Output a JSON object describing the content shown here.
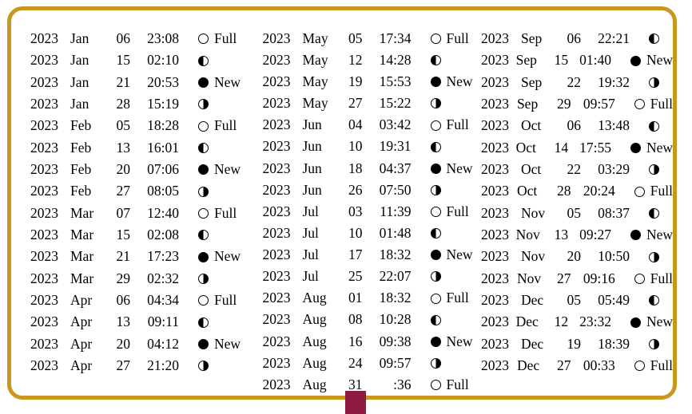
{
  "panel": {
    "border_color": "#c8981e",
    "background_color": "#ffffff"
  },
  "artifact": {
    "name": "cursor-artifact",
    "color": "#8e1b41"
  },
  "phase_labels": {
    "full": "Full",
    "new": "New",
    "first_quarter": "",
    "last_quarter": ""
  },
  "icons": {
    "full": "moon-full-icon",
    "new": "moon-new-icon",
    "first_quarter": "moon-first-quarter-icon",
    "last_quarter": "moon-last-quarter-icon"
  },
  "columns": [
    {
      "rows": [
        {
          "year": "2023",
          "month": "Jan",
          "day": "06",
          "time": "23:08",
          "phase": "full",
          "label": "Full"
        },
        {
          "year": "2023",
          "month": "Jan",
          "day": "15",
          "time": "02:10",
          "phase": "q1",
          "label": ""
        },
        {
          "year": "2023",
          "month": "Jan",
          "day": "21",
          "time": "20:53",
          "phase": "new",
          "label": "New"
        },
        {
          "year": "2023",
          "month": "Jan",
          "day": "28",
          "time": "15:19",
          "phase": "q3",
          "label": ""
        },
        {
          "year": "2023",
          "month": "Feb",
          "day": "05",
          "time": "18:28",
          "phase": "full",
          "label": "Full"
        },
        {
          "year": "2023",
          "month": "Feb",
          "day": "13",
          "time": "16:01",
          "phase": "q1",
          "label": ""
        },
        {
          "year": "2023",
          "month": "Feb",
          "day": "20",
          "time": "07:06",
          "phase": "new",
          "label": "New"
        },
        {
          "year": "2023",
          "month": "Feb",
          "day": "27",
          "time": "08:05",
          "phase": "q3",
          "label": ""
        },
        {
          "year": "2023",
          "month": "Mar",
          "day": "07",
          "time": "12:40",
          "phase": "full",
          "label": "Full"
        },
        {
          "year": "2023",
          "month": "Mar",
          "day": "15",
          "time": "02:08",
          "phase": "q1",
          "label": ""
        },
        {
          "year": "2023",
          "month": "Mar",
          "day": "21",
          "time": "17:23",
          "phase": "new",
          "label": "New"
        },
        {
          "year": "2023",
          "month": "Mar",
          "day": "29",
          "time": "02:32",
          "phase": "q3",
          "label": ""
        },
        {
          "year": "2023",
          "month": "Apr",
          "day": "06",
          "time": "04:34",
          "phase": "full",
          "label": "Full"
        },
        {
          "year": "2023",
          "month": "Apr",
          "day": "13",
          "time": "09:11",
          "phase": "q1",
          "label": ""
        },
        {
          "year": "2023",
          "month": "Apr",
          "day": "20",
          "time": "04:12",
          "phase": "new",
          "label": "New"
        },
        {
          "year": "2023",
          "month": "Apr",
          "day": "27",
          "time": "21:20",
          "phase": "q3",
          "label": ""
        }
      ]
    },
    {
      "rows": [
        {
          "year": "2023",
          "month": "May",
          "day": "05",
          "time": "17:34",
          "phase": "full",
          "label": "Full"
        },
        {
          "year": "2023",
          "month": "May",
          "day": "12",
          "time": "14:28",
          "phase": "q1",
          "label": ""
        },
        {
          "year": "2023",
          "month": "May",
          "day": "19",
          "time": "15:53",
          "phase": "new",
          "label": "New"
        },
        {
          "year": "2023",
          "month": "May",
          "day": "27",
          "time": "15:22",
          "phase": "q3",
          "label": ""
        },
        {
          "year": "2023",
          "month": "Jun",
          "day": "04",
          "time": "03:42",
          "phase": "full",
          "label": "Full"
        },
        {
          "year": "2023",
          "month": "Jun",
          "day": "10",
          "time": "19:31",
          "phase": "q1",
          "label": ""
        },
        {
          "year": "2023",
          "month": "Jun",
          "day": "18",
          "time": "04:37",
          "phase": "new",
          "label": "New"
        },
        {
          "year": "2023",
          "month": "Jun",
          "day": "26",
          "time": "07:50",
          "phase": "q3",
          "label": ""
        },
        {
          "year": "2023",
          "month": "Jul",
          "day": "03",
          "time": "11:39",
          "phase": "full",
          "label": "Full"
        },
        {
          "year": "2023",
          "month": "Jul",
          "day": "10",
          "time": "01:48",
          "phase": "q1",
          "label": ""
        },
        {
          "year": "2023",
          "month": "Jul",
          "day": "17",
          "time": "18:32",
          "phase": "new",
          "label": "New"
        },
        {
          "year": "2023",
          "month": "Jul",
          "day": "25",
          "time": "22:07",
          "phase": "q3",
          "label": ""
        },
        {
          "year": "2023",
          "month": "Aug",
          "day": "01",
          "time": "18:32",
          "phase": "full",
          "label": "Full"
        },
        {
          "year": "2023",
          "month": "Aug",
          "day": "08",
          "time": "10:28",
          "phase": "q1",
          "label": ""
        },
        {
          "year": "2023",
          "month": "Aug",
          "day": "16",
          "time": "09:38",
          "phase": "new",
          "label": "New"
        },
        {
          "year": "2023",
          "month": "Aug",
          "day": "24",
          "time": "09:57",
          "phase": "q3",
          "label": ""
        },
        {
          "year": "2023",
          "month": "Aug",
          "day": "31",
          "time": ":36",
          "phase": "full",
          "label": "Full"
        }
      ]
    },
    {
      "rows": [
        {
          "year": "2023",
          "month": "Sep",
          "day": "06",
          "time": "22:21",
          "phase": "q1",
          "label": ""
        },
        {
          "year": "2023",
          "month": "Sep",
          "day": "15",
          "time": "01:40",
          "phase": "new",
          "label": "New"
        },
        {
          "year": "2023",
          "month": "Sep",
          "day": "22",
          "time": "19:32",
          "phase": "q3",
          "label": ""
        },
        {
          "year": "2023",
          "month": "Sep",
          "day": "29",
          "time": "09:57",
          "phase": "full",
          "label": "Full"
        },
        {
          "year": "2023",
          "month": "Oct",
          "day": "06",
          "time": "13:48",
          "phase": "q1",
          "label": ""
        },
        {
          "year": "2023",
          "month": "Oct",
          "day": "14",
          "time": "17:55",
          "phase": "new",
          "label": "New"
        },
        {
          "year": "2023",
          "month": "Oct",
          "day": "22",
          "time": "03:29",
          "phase": "q3",
          "label": ""
        },
        {
          "year": "2023",
          "month": "Oct",
          "day": "28",
          "time": "20:24",
          "phase": "full",
          "label": "Full"
        },
        {
          "year": "2023",
          "month": "Nov",
          "day": "05",
          "time": "08:37",
          "phase": "q1",
          "label": ""
        },
        {
          "year": "2023",
          "month": "Nov",
          "day": "13",
          "time": "09:27",
          "phase": "new",
          "label": "New"
        },
        {
          "year": "2023",
          "month": "Nov",
          "day": "20",
          "time": "10:50",
          "phase": "q3",
          "label": ""
        },
        {
          "year": "2023",
          "month": "Nov",
          "day": "27",
          "time": "09:16",
          "phase": "full",
          "label": "Full"
        },
        {
          "year": "2023",
          "month": "Dec",
          "day": "05",
          "time": "05:49",
          "phase": "q1",
          "label": ""
        },
        {
          "year": "2023",
          "month": "Dec",
          "day": "12",
          "time": "23:32",
          "phase": "new",
          "label": "New"
        },
        {
          "year": "2023",
          "month": "Dec",
          "day": "19",
          "time": "18:39",
          "phase": "q3",
          "label": ""
        },
        {
          "year": "2023",
          "month": "Dec",
          "day": "27",
          "time": "00:33",
          "phase": "full",
          "label": "Full"
        }
      ]
    }
  ]
}
